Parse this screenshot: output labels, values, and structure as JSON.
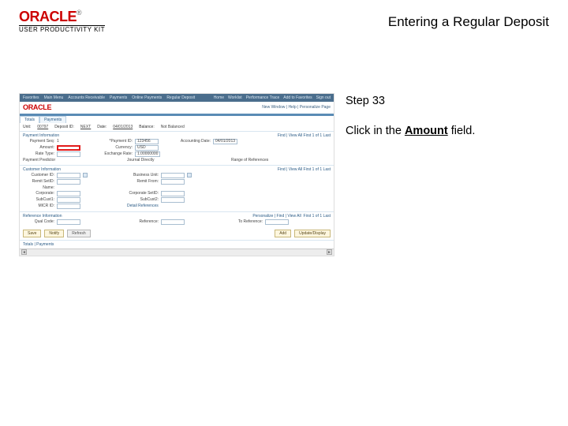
{
  "header": {
    "product_brand": "ORACLE",
    "product_sub": "USER PRODUCTIVITY KIT",
    "page_title": "Entering a Regular Deposit"
  },
  "instructions": {
    "step_label": "Step 33",
    "line_prefix": "Click in the ",
    "line_bold": "Amount",
    "line_suffix": " field."
  },
  "shot": {
    "topbar": {
      "items": [
        "Favorites",
        "Main Menu",
        "Accounts Receivable",
        "Payments",
        "Online Payments",
        "Regular Deposit"
      ],
      "right": [
        "Home",
        "Worklist",
        "Performance Trace",
        "Add to Favorites",
        "Sign out"
      ]
    },
    "brand": "ORACLE",
    "personalize": "New Window | Help | Personalize Page",
    "tabs": [
      "Totals",
      "Payments"
    ],
    "filters": {
      "unit_label": "Unit:",
      "unit_value": "00797",
      "depid_label": "Deposit ID:",
      "depid_value": "NEXT",
      "date_label": "Date:",
      "date_value": "04/01/2013",
      "balance_label": "Balance:",
      "balance_value": "Not Balanced"
    },
    "payinfo": {
      "head": "Payment Information",
      "seq_label": "Payment Seq:",
      "seq_val": "1",
      "payid_label": "*Payment ID:",
      "payid_val": "123456",
      "acct_label": "Accounting Date:",
      "acct_val": "04/01/2013",
      "amount_label": "Amount:",
      "amount_val": "",
      "currency_label": "Currency:",
      "currency_val": "USD",
      "rate_type_label": "Rate Type:",
      "exchange_label": "Exchange Rate:",
      "exchange_val": "1.00000000",
      "predictor_label": "Payment Predictor",
      "journal_label": "Journal Directly",
      "range_label": "Range of References",
      "findfirst_label": "Find | View All    First 1 of 1 Last"
    },
    "custinfo": {
      "head": "Customer Information",
      "custid_label": "Customer ID:",
      "bu_label": "Business Unit:",
      "remit_label": "Remit SetID:",
      "remitfrom_label": "Remit From:",
      "name_label": "Name:",
      "corp_label": "Corporate:",
      "corpsetid_label": "Corporate SetID:",
      "subcust1_label": "SubCust1:",
      "subcust2_label": "SubCust2:",
      "micr_label": "MICR ID:",
      "link": "Detail References"
    },
    "refinfo": {
      "head": "Reference Information",
      "qual_label": "Qual Code:",
      "ref_label": "Reference:",
      "to_label": "To Reference:",
      "pers_label": "Personalize | Find | View All",
      "count": "First  1 of 1  Last"
    },
    "buttons": {
      "save": "Save",
      "notify": "Notify",
      "refresh": "Refresh",
      "add": "Add",
      "update": "Update/Display"
    },
    "footer_link": "Totals | Payments"
  }
}
